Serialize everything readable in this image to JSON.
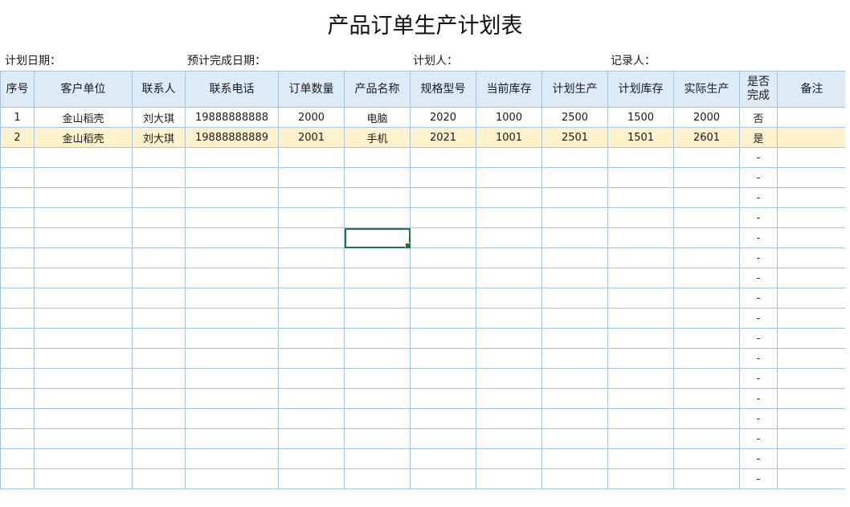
{
  "title": "产品订单生产计划表",
  "meta": {
    "plan_date_label": "计划日期：",
    "expected_finish_label": "预计完成日期：",
    "planner_label": "计划人：",
    "recorder_label": "记录人："
  },
  "columns": [
    {
      "key": "seq",
      "label": "序号"
    },
    {
      "key": "customer",
      "label": "客户单位"
    },
    {
      "key": "contact",
      "label": "联系人"
    },
    {
      "key": "phone",
      "label": "联系电话"
    },
    {
      "key": "order_qty",
      "label": "订单数量"
    },
    {
      "key": "product",
      "label": "产品名称"
    },
    {
      "key": "spec",
      "label": "规格型号"
    },
    {
      "key": "stock",
      "label": "当前库存"
    },
    {
      "key": "plan_prod",
      "label": "计划生产"
    },
    {
      "key": "plan_stock",
      "label": "计划库存"
    },
    {
      "key": "actual_prod",
      "label": "实际生产"
    },
    {
      "key": "done",
      "label": "是否\n完成"
    },
    {
      "key": "remark",
      "label": "备注"
    }
  ],
  "rows": [
    {
      "seq": "1",
      "customer": "金山稻壳",
      "contact": "刘大琪",
      "phone": "19888888888",
      "order_qty": "2000",
      "product": "电脑",
      "spec": "2020",
      "stock": "1000",
      "plan_prod": "2500",
      "plan_stock": "1500",
      "actual_prod": "2000",
      "done": "否",
      "remark": ""
    },
    {
      "seq": "2",
      "customer": "金山稻壳",
      "contact": "刘大琪",
      "phone": "19888888889",
      "order_qty": "2001",
      "product": "手机",
      "spec": "2021",
      "stock": "1001",
      "plan_prod": "2501",
      "plan_stock": "1501",
      "actual_prod": "2601",
      "done": "是",
      "remark": ""
    },
    {
      "seq": "",
      "customer": "",
      "contact": "",
      "phone": "",
      "order_qty": "",
      "product": "",
      "spec": "",
      "stock": "",
      "plan_prod": "",
      "plan_stock": "",
      "actual_prod": "",
      "done": "-",
      "remark": ""
    },
    {
      "seq": "",
      "customer": "",
      "contact": "",
      "phone": "",
      "order_qty": "",
      "product": "",
      "spec": "",
      "stock": "",
      "plan_prod": "",
      "plan_stock": "",
      "actual_prod": "",
      "done": "-",
      "remark": ""
    },
    {
      "seq": "",
      "customer": "",
      "contact": "",
      "phone": "",
      "order_qty": "",
      "product": "",
      "spec": "",
      "stock": "",
      "plan_prod": "",
      "plan_stock": "",
      "actual_prod": "",
      "done": "-",
      "remark": ""
    },
    {
      "seq": "",
      "customer": "",
      "contact": "",
      "phone": "",
      "order_qty": "",
      "product": "",
      "spec": "",
      "stock": "",
      "plan_prod": "",
      "plan_stock": "",
      "actual_prod": "",
      "done": "-",
      "remark": ""
    },
    {
      "seq": "",
      "customer": "",
      "contact": "",
      "phone": "",
      "order_qty": "",
      "product": "",
      "spec": "",
      "stock": "",
      "plan_prod": "",
      "plan_stock": "",
      "actual_prod": "",
      "done": "-",
      "remark": ""
    },
    {
      "seq": "",
      "customer": "",
      "contact": "",
      "phone": "",
      "order_qty": "",
      "product": "",
      "spec": "",
      "stock": "",
      "plan_prod": "",
      "plan_stock": "",
      "actual_prod": "",
      "done": "-",
      "remark": ""
    },
    {
      "seq": "",
      "customer": "",
      "contact": "",
      "phone": "",
      "order_qty": "",
      "product": "",
      "spec": "",
      "stock": "",
      "plan_prod": "",
      "plan_stock": "",
      "actual_prod": "",
      "done": "-",
      "remark": ""
    },
    {
      "seq": "",
      "customer": "",
      "contact": "",
      "phone": "",
      "order_qty": "",
      "product": "",
      "spec": "",
      "stock": "",
      "plan_prod": "",
      "plan_stock": "",
      "actual_prod": "",
      "done": "-",
      "remark": ""
    },
    {
      "seq": "",
      "customer": "",
      "contact": "",
      "phone": "",
      "order_qty": "",
      "product": "",
      "spec": "",
      "stock": "",
      "plan_prod": "",
      "plan_stock": "",
      "actual_prod": "",
      "done": "-",
      "remark": ""
    },
    {
      "seq": "",
      "customer": "",
      "contact": "",
      "phone": "",
      "order_qty": "",
      "product": "",
      "spec": "",
      "stock": "",
      "plan_prod": "",
      "plan_stock": "",
      "actual_prod": "",
      "done": "-",
      "remark": ""
    },
    {
      "seq": "",
      "customer": "",
      "contact": "",
      "phone": "",
      "order_qty": "",
      "product": "",
      "spec": "",
      "stock": "",
      "plan_prod": "",
      "plan_stock": "",
      "actual_prod": "",
      "done": "-",
      "remark": ""
    },
    {
      "seq": "",
      "customer": "",
      "contact": "",
      "phone": "",
      "order_qty": "",
      "product": "",
      "spec": "",
      "stock": "",
      "plan_prod": "",
      "plan_stock": "",
      "actual_prod": "",
      "done": "-",
      "remark": ""
    },
    {
      "seq": "",
      "customer": "",
      "contact": "",
      "phone": "",
      "order_qty": "",
      "product": "",
      "spec": "",
      "stock": "",
      "plan_prod": "",
      "plan_stock": "",
      "actual_prod": "",
      "done": "-",
      "remark": ""
    },
    {
      "seq": "",
      "customer": "",
      "contact": "",
      "phone": "",
      "order_qty": "",
      "product": "",
      "spec": "",
      "stock": "",
      "plan_prod": "",
      "plan_stock": "",
      "actual_prod": "",
      "done": "-",
      "remark": ""
    },
    {
      "seq": "",
      "customer": "",
      "contact": "",
      "phone": "",
      "order_qty": "",
      "product": "",
      "spec": "",
      "stock": "",
      "plan_prod": "",
      "plan_stock": "",
      "actual_prod": "",
      "done": "-",
      "remark": ""
    },
    {
      "seq": "",
      "customer": "",
      "contact": "",
      "phone": "",
      "order_qty": "",
      "product": "",
      "spec": "",
      "stock": "",
      "plan_prod": "",
      "plan_stock": "",
      "actual_prod": "",
      "done": "-",
      "remark": ""
    },
    {
      "seq": "",
      "customer": "",
      "contact": "",
      "phone": "",
      "order_qty": "",
      "product": "",
      "spec": "",
      "stock": "",
      "plan_prod": "",
      "plan_stock": "",
      "actual_prod": "",
      "done": "-",
      "remark": ""
    }
  ],
  "colors": {
    "header_fill": "#ddebf7",
    "highlight_row_fill": "#fff2cc",
    "grid_line": "#a7c3dc",
    "selection_outline": "#217346"
  }
}
